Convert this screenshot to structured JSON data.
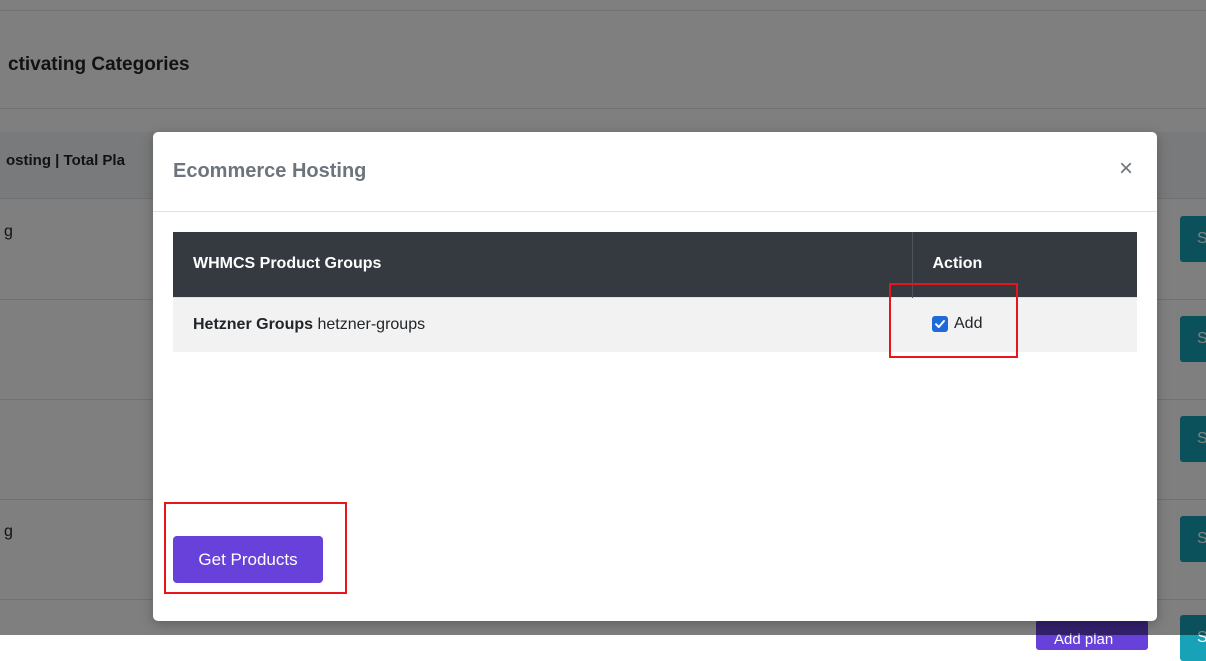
{
  "background": {
    "card_title": "ctivating Categories",
    "column_header": "osting | Total Pla",
    "rows": [
      {
        "text": "g"
      },
      {
        "text": ""
      },
      {
        "text": ""
      },
      {
        "text": "g"
      }
    ],
    "side_button_label": "S",
    "add_plan_label": "Add plan"
  },
  "modal": {
    "title": "Ecommerce Hosting",
    "close_glyph": "×",
    "table": {
      "columns": [
        "WHMCS Product Groups",
        "Action"
      ],
      "rows": [
        {
          "name": "Hetzner Groups",
          "slug": "hetzner-groups",
          "checked": true,
          "action_label": "Add"
        }
      ]
    },
    "submit_label": "Get Products"
  },
  "colors": {
    "primary": "#6741d9",
    "table_header": "#343a40",
    "info": "#17a2b8",
    "checkbox": "#1e6ad6",
    "highlight": "#e8151b"
  },
  "icons": {
    "close": "close-icon",
    "check": "checkmark-icon"
  }
}
